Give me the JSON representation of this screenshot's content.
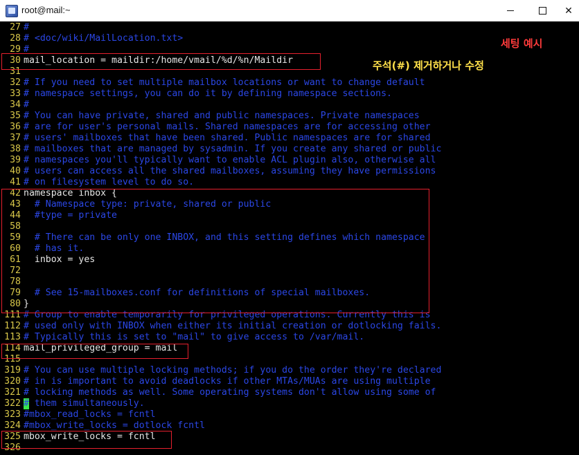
{
  "window": {
    "title": "root@mail:~",
    "minimize_label": "",
    "maximize_label": "",
    "close_label": "✕"
  },
  "annotations": {
    "example_label": "세팅 예시",
    "instruction_label": "주석(#) 제거하거나 수정"
  },
  "lines": [
    {
      "n": "27",
      "t": "#",
      "c": "cmt"
    },
    {
      "n": "28",
      "t": "# <doc/wiki/MailLocation.txt>",
      "c": "cmt"
    },
    {
      "n": "29",
      "t": "#",
      "c": "cmt"
    },
    {
      "n": "30",
      "t": "mail_location = maildir:/home/vmail/%d/%n/Maildir",
      "c": "key"
    },
    {
      "n": "31",
      "t": "",
      "c": "key"
    },
    {
      "n": "32",
      "t": "# If you need to set multiple mailbox locations or want to change default",
      "c": "cmt"
    },
    {
      "n": "33",
      "t": "# namespace settings, you can do it by defining namespace sections.",
      "c": "cmt"
    },
    {
      "n": "34",
      "t": "#",
      "c": "cmt"
    },
    {
      "n": "35",
      "t": "# You can have private, shared and public namespaces. Private namespaces",
      "c": "cmt"
    },
    {
      "n": "36",
      "t": "# are for user's personal mails. Shared namespaces are for accessing other",
      "c": "cmt"
    },
    {
      "n": "37",
      "t": "# users' mailboxes that have been shared. Public namespaces are for shared",
      "c": "cmt"
    },
    {
      "n": "38",
      "t": "# mailboxes that are managed by sysadmin. If you create any shared or public",
      "c": "cmt"
    },
    {
      "n": "39",
      "t": "# namespaces you'll typically want to enable ACL plugin also, otherwise all",
      "c": "cmt"
    },
    {
      "n": "40",
      "t": "# users can access all the shared mailboxes, assuming they have permissions",
      "c": "cmt"
    },
    {
      "n": "41",
      "t": "# on filesystem level to do so.",
      "c": "cmt"
    },
    {
      "n": "42",
      "t": "namespace inbox {",
      "c": "key"
    },
    {
      "n": "43",
      "t": "  # Namespace type: private, shared or public",
      "c": "cmt"
    },
    {
      "n": "44",
      "t": "  #type = private",
      "c": "cmt"
    },
    {
      "n": "58",
      "t": "",
      "c": "key"
    },
    {
      "n": "59",
      "t": "  # There can be only one INBOX, and this setting defines which namespace",
      "c": "cmt"
    },
    {
      "n": "60",
      "t": "  # has it.",
      "c": "cmt"
    },
    {
      "n": "61",
      "t": "  inbox = yes",
      "c": "key"
    },
    {
      "n": "72",
      "t": "",
      "c": "key"
    },
    {
      "n": "78",
      "t": "",
      "c": "key"
    },
    {
      "n": "79",
      "t": "  # See 15-mailboxes.conf for definitions of special mailboxes.",
      "c": "cmt"
    },
    {
      "n": "80",
      "t": "}",
      "c": "key"
    },
    {
      "n": "111",
      "t": "# Group to enable temporarily for privileged operations. Currently this is",
      "c": "cmt"
    },
    {
      "n": "112",
      "t": "# used only with INBOX when either its initial creation or dotlocking fails.",
      "c": "cmt"
    },
    {
      "n": "113",
      "t": "# Typically this is set to \"mail\" to give access to /var/mail.",
      "c": "cmt"
    },
    {
      "n": "114",
      "t": "mail_privileged_group = mail",
      "c": "key"
    },
    {
      "n": "115",
      "t": "",
      "c": "key"
    },
    {
      "n": "319",
      "t": "# You can use multiple locking methods; if you do the order they're declared",
      "c": "cmt"
    },
    {
      "n": "320",
      "t": "# in is important to avoid deadlocks if other MTAs/MUAs are using multiple",
      "c": "cmt"
    },
    {
      "n": "321",
      "t": "# locking methods as well. Some operating systems don't allow using some of",
      "c": "cmt"
    },
    {
      "n": "322",
      "t": "# them simultaneously.",
      "c": "cmt",
      "cursor": true
    },
    {
      "n": "323",
      "t": "#mbox_read_locks = fcntl",
      "c": "cmt"
    },
    {
      "n": "324",
      "t": "#mbox_write_locks = dotlock fcntl",
      "c": "cmt"
    },
    {
      "n": "325",
      "t": "mbox_write_locks = fcntl",
      "c": "key"
    },
    {
      "n": "326",
      "t": "",
      "c": "key"
    }
  ],
  "colors": {
    "line_number": "#d9c84a",
    "comment": "#2b47e6",
    "text": "#e8e8e8",
    "highlight_box": "#e8202e",
    "cursor": "#37e84a"
  }
}
